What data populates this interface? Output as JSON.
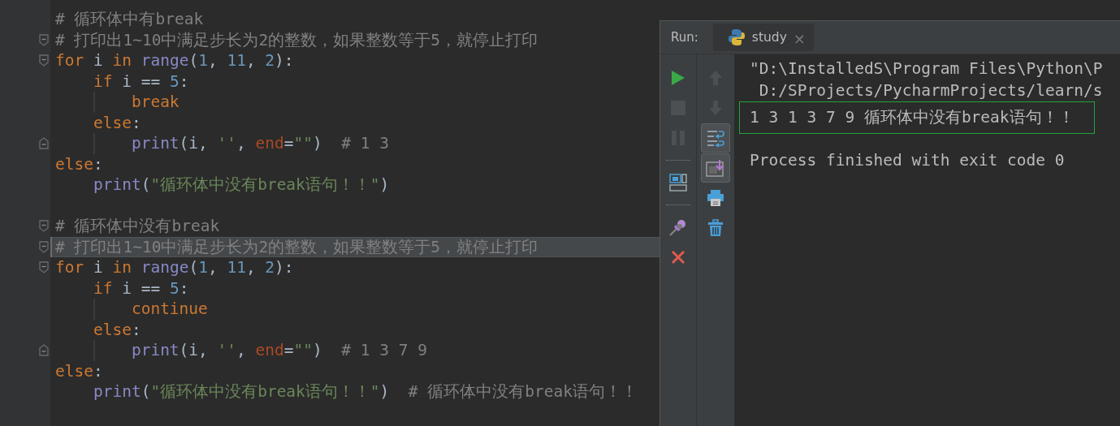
{
  "code_lines": [
    {
      "kind": "code",
      "tokens": [
        {
          "kind": "comment",
          "text": "# 循环体中有break"
        }
      ],
      "current": false,
      "fold_start": false,
      "fold_end": false
    },
    {
      "kind": "code",
      "tokens": [
        {
          "kind": "comment",
          "text": "# 打印出1~10中满足步长为2的整数，如果整数等于5，就停止打印"
        }
      ],
      "current": false,
      "fold_start": true,
      "fold_end": false
    },
    {
      "kind": "code",
      "tokens": [
        {
          "kind": "kw",
          "text": "for"
        },
        {
          "kind": "name",
          "text": " i "
        },
        {
          "kind": "kw",
          "text": "in"
        },
        {
          "kind": "builtin",
          "text": " range"
        },
        {
          "kind": "punct",
          "text": "("
        },
        {
          "kind": "num",
          "text": "1"
        },
        {
          "kind": "punct",
          "text": ", "
        },
        {
          "kind": "num",
          "text": "11"
        },
        {
          "kind": "punct",
          "text": ", "
        },
        {
          "kind": "num",
          "text": "2"
        },
        {
          "kind": "punct",
          "text": "):"
        }
      ],
      "current": false,
      "fold_start": true,
      "fold_end": false,
      "children": [
        {
          "kind": "code",
          "tokens": [
            {
              "kind": "kw",
              "text": "if"
            },
            {
              "kind": "name",
              "text": " i == "
            },
            {
              "kind": "num",
              "text": "5"
            },
            {
              "kind": "punct",
              "text": ":"
            }
          ],
          "current": false,
          "fold_start": false,
          "fold_end": false,
          "children": [
            {
              "kind": "code",
              "tokens": [
                {
                  "kind": "kw",
                  "text": "break"
                }
              ],
              "current": false,
              "fold_start": false,
              "fold_end": false
            }
          ]
        },
        {
          "kind": "code",
          "tokens": [
            {
              "kind": "kw",
              "text": "else"
            },
            {
              "kind": "punct",
              "text": ":"
            }
          ],
          "current": false,
          "fold_start": false,
          "fold_end": false,
          "children": [
            {
              "kind": "code",
              "tokens": [
                {
                  "kind": "builtin",
                  "text": "print"
                },
                {
                  "kind": "punct",
                  "text": "(i, "
                },
                {
                  "kind": "str",
                  "text": "''"
                },
                {
                  "kind": "punct",
                  "text": ", "
                },
                {
                  "kind": "param",
                  "text": "end"
                },
                {
                  "kind": "punct",
                  "text": "="
                },
                {
                  "kind": "str",
                  "text": "\"\""
                },
                {
                  "kind": "punct",
                  "text": ")  "
                },
                {
                  "kind": "comment",
                  "text": "# 1 3"
                }
              ],
              "current": false,
              "fold_start": false,
              "fold_end": true
            }
          ]
        }
      ]
    },
    {
      "kind": "code",
      "tokens": [
        {
          "kind": "kw",
          "text": "else"
        },
        {
          "kind": "punct",
          "text": ":"
        }
      ],
      "current": false,
      "fold_start": false,
      "fold_end": false,
      "children": [
        {
          "kind": "code",
          "tokens": [
            {
              "kind": "builtin",
              "text": "print"
            },
            {
              "kind": "punct",
              "text": "("
            },
            {
              "kind": "str",
              "text": "\"循环体中没有break语句！！\""
            },
            {
              "kind": "punct",
              "text": ")"
            }
          ],
          "current": false,
          "fold_start": false,
          "fold_end": false
        }
      ]
    },
    {
      "kind": "blank"
    },
    {
      "kind": "code",
      "tokens": [
        {
          "kind": "comment",
          "text": "# 循环体中没有break"
        }
      ],
      "current": false,
      "fold_start": true,
      "fold_end": false
    },
    {
      "kind": "code",
      "tokens": [
        {
          "kind": "comment",
          "text": "# 打印出1~10中满足步长为2的整数，如果整数等于5，就停止打印"
        }
      ],
      "current": true,
      "fold_start": true,
      "fold_end": false
    },
    {
      "kind": "code",
      "tokens": [
        {
          "kind": "kw",
          "text": "for"
        },
        {
          "kind": "name",
          "text": " i "
        },
        {
          "kind": "kw",
          "text": "in"
        },
        {
          "kind": "builtin",
          "text": " range"
        },
        {
          "kind": "punct",
          "text": "("
        },
        {
          "kind": "num",
          "text": "1"
        },
        {
          "kind": "punct",
          "text": ", "
        },
        {
          "kind": "num",
          "text": "11"
        },
        {
          "kind": "punct",
          "text": ", "
        },
        {
          "kind": "num",
          "text": "2"
        },
        {
          "kind": "punct",
          "text": "):"
        }
      ],
      "current": false,
      "fold_start": true,
      "fold_end": false,
      "children": [
        {
          "kind": "code",
          "tokens": [
            {
              "kind": "kw",
              "text": "if"
            },
            {
              "kind": "name",
              "text": " i == "
            },
            {
              "kind": "num",
              "text": "5"
            },
            {
              "kind": "punct",
              "text": ":"
            }
          ],
          "current": false,
          "fold_start": false,
          "fold_end": false,
          "children": [
            {
              "kind": "code",
              "tokens": [
                {
                  "kind": "kw",
                  "text": "continue"
                }
              ],
              "current": false,
              "fold_start": false,
              "fold_end": false
            }
          ]
        },
        {
          "kind": "code",
          "tokens": [
            {
              "kind": "kw",
              "text": "else"
            },
            {
              "kind": "punct",
              "text": ":"
            }
          ],
          "current": false,
          "fold_start": false,
          "fold_end": false,
          "children": [
            {
              "kind": "code",
              "tokens": [
                {
                  "kind": "builtin",
                  "text": "print"
                },
                {
                  "kind": "punct",
                  "text": "(i, "
                },
                {
                  "kind": "str",
                  "text": "''"
                },
                {
                  "kind": "punct",
                  "text": ", "
                },
                {
                  "kind": "param",
                  "text": "end"
                },
                {
                  "kind": "punct",
                  "text": "="
                },
                {
                  "kind": "str",
                  "text": "\"\""
                },
                {
                  "kind": "punct",
                  "text": ")  "
                },
                {
                  "kind": "comment",
                  "text": "# 1 3 7 9"
                }
              ],
              "current": false,
              "fold_start": false,
              "fold_end": true
            }
          ]
        }
      ]
    },
    {
      "kind": "code",
      "tokens": [
        {
          "kind": "kw",
          "text": "else"
        },
        {
          "kind": "punct",
          "text": ":"
        }
      ],
      "current": false,
      "fold_start": false,
      "fold_end": false,
      "children": [
        {
          "kind": "code",
          "tokens": [
            {
              "kind": "builtin",
              "text": "print"
            },
            {
              "kind": "punct",
              "text": "("
            },
            {
              "kind": "str",
              "text": "\"循环体中没有break语句！！\""
            },
            {
              "kind": "punct",
              "text": ")  "
            },
            {
              "kind": "comment",
              "text": "# 循环体中没有break语句！！"
            }
          ],
          "current": false,
          "fold_start": false,
          "fold_end": false
        }
      ]
    }
  ],
  "run_panel": {
    "title": "Run:",
    "tab": {
      "label": "study",
      "close": "×"
    },
    "tools_left": [
      {
        "kind": "run",
        "disabled": false
      },
      {
        "kind": "stop",
        "disabled": true
      },
      {
        "kind": "pause",
        "disabled": true
      },
      {
        "kind": "separator"
      },
      {
        "kind": "layout",
        "disabled": false
      },
      {
        "kind": "separator"
      },
      {
        "kind": "pin",
        "disabled": false
      },
      {
        "kind": "close",
        "disabled": false
      }
    ],
    "tools_right": [
      {
        "kind": "up",
        "disabled": true,
        "on": false
      },
      {
        "kind": "down",
        "disabled": true,
        "on": false
      },
      {
        "kind": "wrap",
        "disabled": false,
        "on": true
      },
      {
        "kind": "scroll",
        "disabled": false,
        "on": true
      },
      {
        "kind": "print",
        "disabled": false,
        "on": false
      },
      {
        "kind": "trash",
        "disabled": false,
        "on": false
      }
    ],
    "console": [
      {
        "kind": "command",
        "text": "\"D:\\InstalledS\\Program Files\\Python\\P",
        "highlighted": false
      },
      {
        "kind": "command",
        "text": " D:/SProjects/PycharmProjects/learn/s",
        "highlighted": false
      },
      {
        "kind": "output",
        "text": "1 3 1 3 7 9 循环体中没有break语句！！",
        "highlighted": true
      },
      {
        "kind": "exit",
        "text": "Process finished with exit code 0",
        "highlighted": false
      }
    ]
  }
}
